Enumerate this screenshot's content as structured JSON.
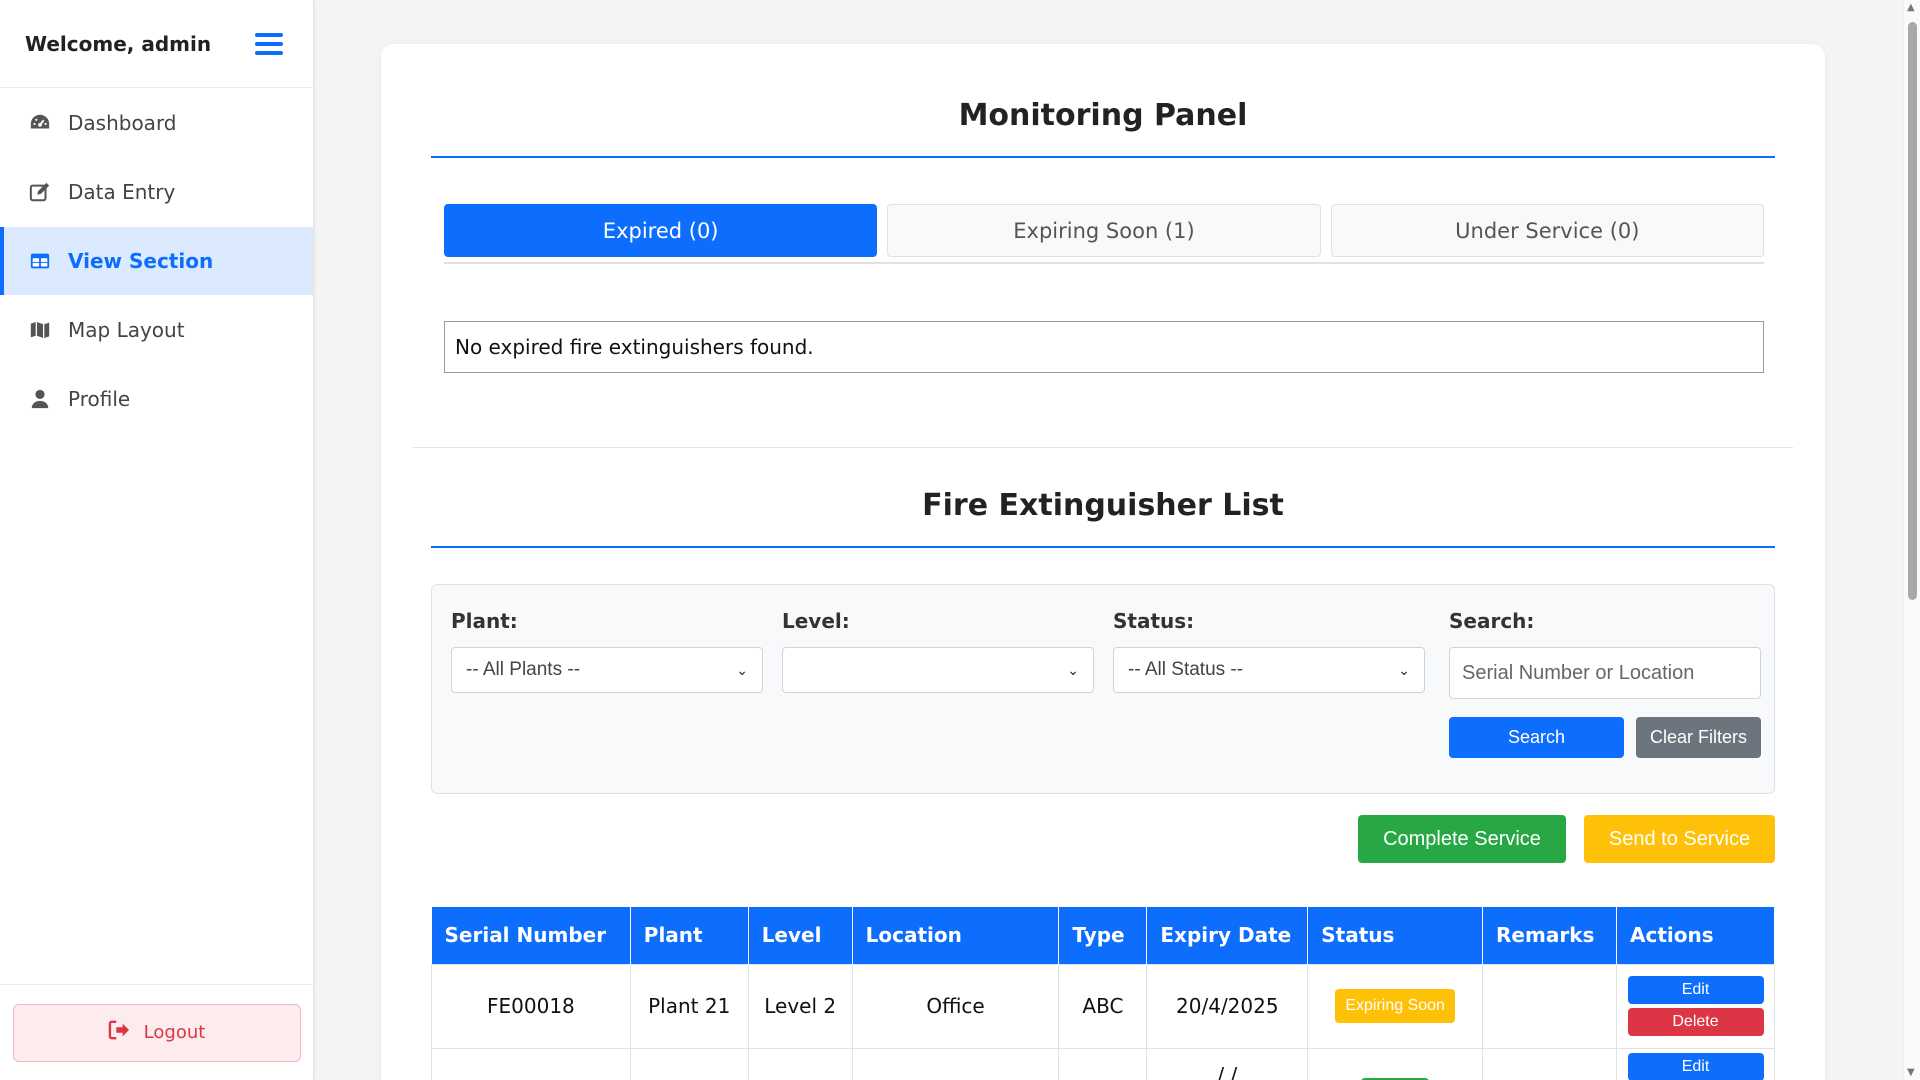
{
  "sidebar": {
    "welcome": "Welcome, admin",
    "items": [
      {
        "label": "Dashboard",
        "icon": "dashboard-gauge-icon"
      },
      {
        "label": "Data Entry",
        "icon": "edit-icon"
      },
      {
        "label": "View Section",
        "icon": "table-icon",
        "active": true
      },
      {
        "label": "Map Layout",
        "icon": "map-icon"
      },
      {
        "label": "Profile",
        "icon": "user-icon"
      }
    ],
    "logout_label": "Logout"
  },
  "monitoring": {
    "title": "Monitoring Panel",
    "tabs": [
      {
        "label": "Expired (0)",
        "active": true
      },
      {
        "label": "Expiring Soon (1)"
      },
      {
        "label": "Under Service (0)"
      }
    ],
    "empty_message": "No expired fire extinguishers found."
  },
  "list": {
    "title": "Fire Extinguisher List",
    "filters": {
      "plant_label": "Plant:",
      "plant_value": "-- All Plants --",
      "level_label": "Level:",
      "level_value": "",
      "status_label": "Status:",
      "status_value": "-- All Status --",
      "search_label": "Search:",
      "search_placeholder": "Serial Number or Location",
      "search_button": "Search",
      "clear_button": "Clear Filters"
    },
    "actions": {
      "complete_service": "Complete Service",
      "send_to_service": "Send to Service"
    },
    "columns": [
      "Serial Number",
      "Plant",
      "Level",
      "Location",
      "Type",
      "Expiry Date",
      "Status",
      "Remarks",
      "Actions"
    ],
    "rows": [
      {
        "serial": "FE00018",
        "plant": "Plant 21",
        "level": "Level 2",
        "location": "Office",
        "type": "ABC",
        "expiry": "20/4/2025",
        "status": "Expiring Soon",
        "remarks": "",
        "edit": "Edit",
        "delete": "Delete"
      }
    ],
    "partial_row": {
      "expiry": "/ /",
      "edit": "Edit"
    }
  },
  "colors": {
    "primary": "#0d6efd",
    "success": "#28a745",
    "warning": "#ffc107",
    "danger": "#dc3545",
    "secondary": "#6c757d",
    "active_nav_bg": "#dbeafe"
  }
}
